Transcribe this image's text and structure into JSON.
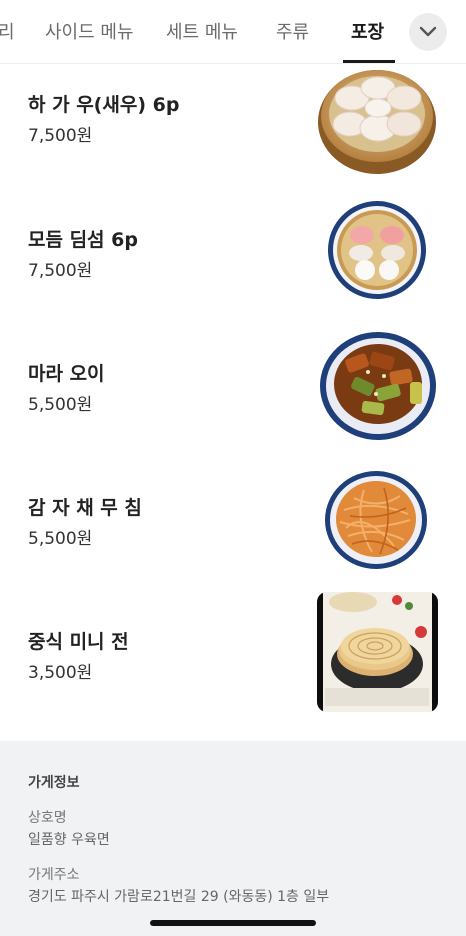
{
  "tabs": [
    {
      "label": "리"
    },
    {
      "label": "사이드 메뉴"
    },
    {
      "label": "세트 메뉴"
    },
    {
      "label": "주류"
    },
    {
      "label": "포장"
    }
  ],
  "active_tab_index": 4,
  "expand_icon": "chevron-down-icon",
  "menu_items": [
    {
      "name": "하 가 우(새우) 6p",
      "price": "7,500원",
      "photo": "har-gow-steamer-photo"
    },
    {
      "name": "모듬 딤섬 6p",
      "price": "7,500원",
      "photo": "assorted-dimsum-photo"
    },
    {
      "name": "마라 오이",
      "price": "5,500원",
      "photo": "mala-cucumber-photo"
    },
    {
      "name": "감 자 채 무 침",
      "price": "5,500원",
      "photo": "potato-strips-photo"
    },
    {
      "name": "중식 미니 전",
      "price": "3,500원",
      "photo": "chinese-pancake-photo"
    }
  ],
  "store_info": {
    "title": "가게정보",
    "name_label": "상호명",
    "name_value": "일품향 우육면",
    "address_label": "가게주소",
    "address_value": "경기도 파주시 가람로21번길 29 (와동동) 1층 일부"
  },
  "colors": {
    "active_tab": "#1a1a1a",
    "inactive_tab": "#6b6b6b",
    "footer_bg": "#f1f2f4",
    "plate_blue": "#1f3f7a"
  }
}
